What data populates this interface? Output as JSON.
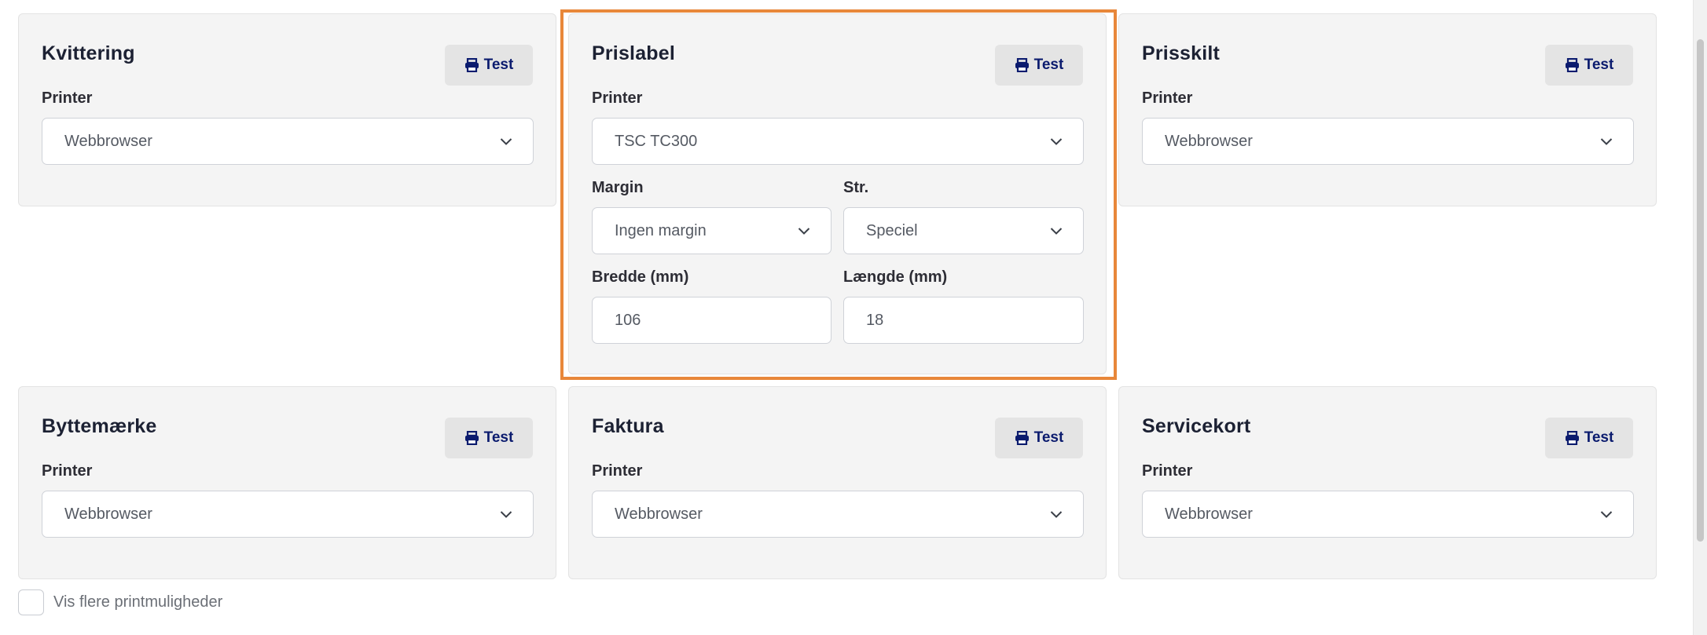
{
  "cards": {
    "kvittering": {
      "title": "Kvittering",
      "test": "Test",
      "printer_label": "Printer",
      "printer_value": "Webbrowser"
    },
    "prislabel": {
      "title": "Prislabel",
      "test": "Test",
      "printer_label": "Printer",
      "printer_value": "TSC TC300",
      "margin_label": "Margin",
      "margin_value": "Ingen margin",
      "size_label": "Str.",
      "size_value": "Speciel",
      "width_label": "Bredde (mm)",
      "width_value": "106",
      "length_label": "Længde (mm)",
      "length_value": "18"
    },
    "prisskilt": {
      "title": "Prisskilt",
      "test": "Test",
      "printer_label": "Printer",
      "printer_value": "Webbrowser"
    },
    "byttemaerke": {
      "title": "Byttemærke",
      "test": "Test",
      "printer_label": "Printer",
      "printer_value": "Webbrowser"
    },
    "faktura": {
      "title": "Faktura",
      "test": "Test",
      "printer_label": "Printer",
      "printer_value": "Webbrowser"
    },
    "servicekort": {
      "title": "Servicekort",
      "test": "Test",
      "printer_label": "Printer",
      "printer_value": "Webbrowser"
    }
  },
  "more_options": {
    "label": "Vis flere printmuligheder",
    "checked": false
  },
  "colors": {
    "accent_highlight": "#e8873a",
    "button_text": "#0b1b6e",
    "card_bg": "#f4f4f4"
  },
  "icons": {
    "test_button": "printer-icon",
    "select": "chevron-down-icon"
  }
}
